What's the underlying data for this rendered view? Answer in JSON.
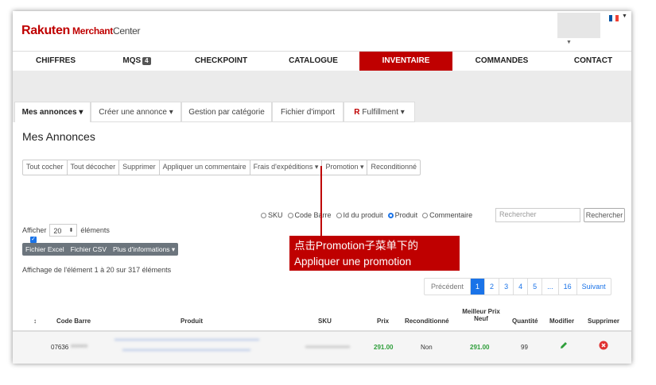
{
  "header": {
    "logo_main": "Rakuten",
    "logo_merchant": "Merchant",
    "logo_center": "Center",
    "flag_colors": [
      "#0055a4",
      "#ffffff",
      "#ef4135"
    ]
  },
  "nav": {
    "items": [
      {
        "label": "CHIFFRES"
      },
      {
        "label": "MQS",
        "badge": "4"
      },
      {
        "label": "CHECKPOINT"
      },
      {
        "label": "CATALOGUE"
      },
      {
        "label": "INVENTAIRE",
        "active": true
      },
      {
        "label": "COMMANDES"
      },
      {
        "label": "CONTACT"
      }
    ],
    "active_color": "#bf0000"
  },
  "tabs": [
    {
      "label": "Mes annonces",
      "caret": "▾",
      "active": true
    },
    {
      "label": "Créer une annonce",
      "caret": "▾"
    },
    {
      "label": "Gestion par catégorie"
    },
    {
      "label": "Fichier d'import"
    },
    {
      "prefix": "R",
      "label": "Fulfillment",
      "caret": "▾"
    }
  ],
  "page": {
    "title": "Mes Annonces"
  },
  "actions": [
    "Tout cocher",
    "Tout décocher",
    "Supprimer",
    "Appliquer un commentaire",
    "Frais d'expéditions ▾",
    "Promotion ▾",
    "Reconditionné"
  ],
  "search": {
    "options": [
      {
        "label": "SKU",
        "checked": false
      },
      {
        "label": "Code Barre",
        "checked": false
      },
      {
        "label": "Id du produit",
        "checked": false
      },
      {
        "label": "Produit",
        "checked": true
      },
      {
        "label": "Commentaire",
        "checked": false
      }
    ],
    "placeholder": "Rechercher",
    "button": "Rechercher"
  },
  "show": {
    "label": "Afficher",
    "value": "20",
    "suffix": "éléments"
  },
  "export": [
    "Fichier Excel",
    "Fichier CSV",
    "Plus d'informations ▾"
  ],
  "summary": "Affichage de l'élément 1 à 20 sur 317 éléments",
  "pagination": {
    "prev": "Précédent",
    "pages": [
      "1",
      "2",
      "3",
      "4",
      "5",
      "...",
      "16"
    ],
    "next": "Suivant",
    "current": "1"
  },
  "table": {
    "headers": {
      "sort": "↕",
      "barcode": "Code Barre",
      "product": "Produit",
      "sku": "SKU",
      "price": "Prix",
      "recond": "Reconditionné",
      "best_price_line1": "Meilleur Prix",
      "best_price_line2": "Neuf",
      "qty": "Quantité",
      "edit": "Modifier",
      "delete": "Supprimer"
    },
    "row": {
      "barcode": "07636",
      "price": "291.00",
      "recond": "Non",
      "best_price": "291.00",
      "qty": "99"
    }
  },
  "callout": {
    "line1": "点击Promotion子菜单下的",
    "line2": "Appliquer une promotion"
  }
}
